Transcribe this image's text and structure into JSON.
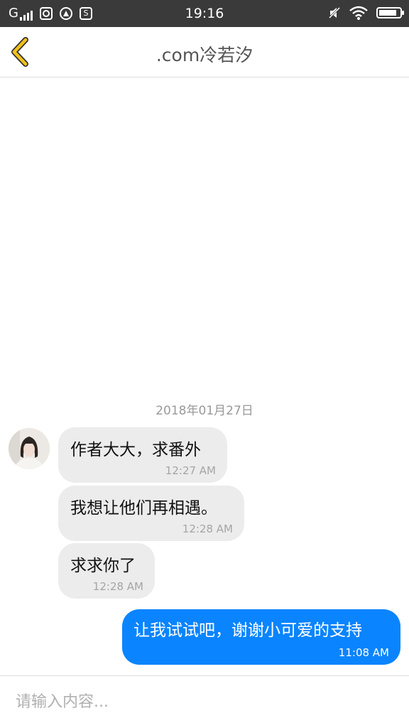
{
  "status_bar": {
    "carrier": "G",
    "time": "19:16",
    "icons": [
      "signal-icon",
      "app-notification-icon",
      "compass-notification-icon",
      "s-notification-icon",
      "mute-icon",
      "wifi-icon",
      "battery-icon"
    ],
    "battery_level": 0.85
  },
  "header": {
    "back_icon": "chevron-left-icon",
    "title": ".com冷若汐"
  },
  "chat": {
    "date": "2018年01月27日",
    "messages": [
      {
        "direction": "in",
        "text": "作者大大，求番外",
        "time": "12:27 AM"
      },
      {
        "direction": "in",
        "text": "我想让他们再相遇。",
        "time": "12:28 AM"
      },
      {
        "direction": "in",
        "text": "求求你了",
        "time": "12:28 AM"
      },
      {
        "direction": "out",
        "text": "让我试试吧，谢谢小可爱的支持",
        "time": "11:08 AM"
      }
    ]
  },
  "composer": {
    "placeholder": "请输入内容...",
    "value": ""
  },
  "colors": {
    "status_bar": "#3a3a3a",
    "accent_back": "#f2c21b",
    "outgoing_bubble": "#0a84ff",
    "incoming_bubble": "#ececec"
  }
}
